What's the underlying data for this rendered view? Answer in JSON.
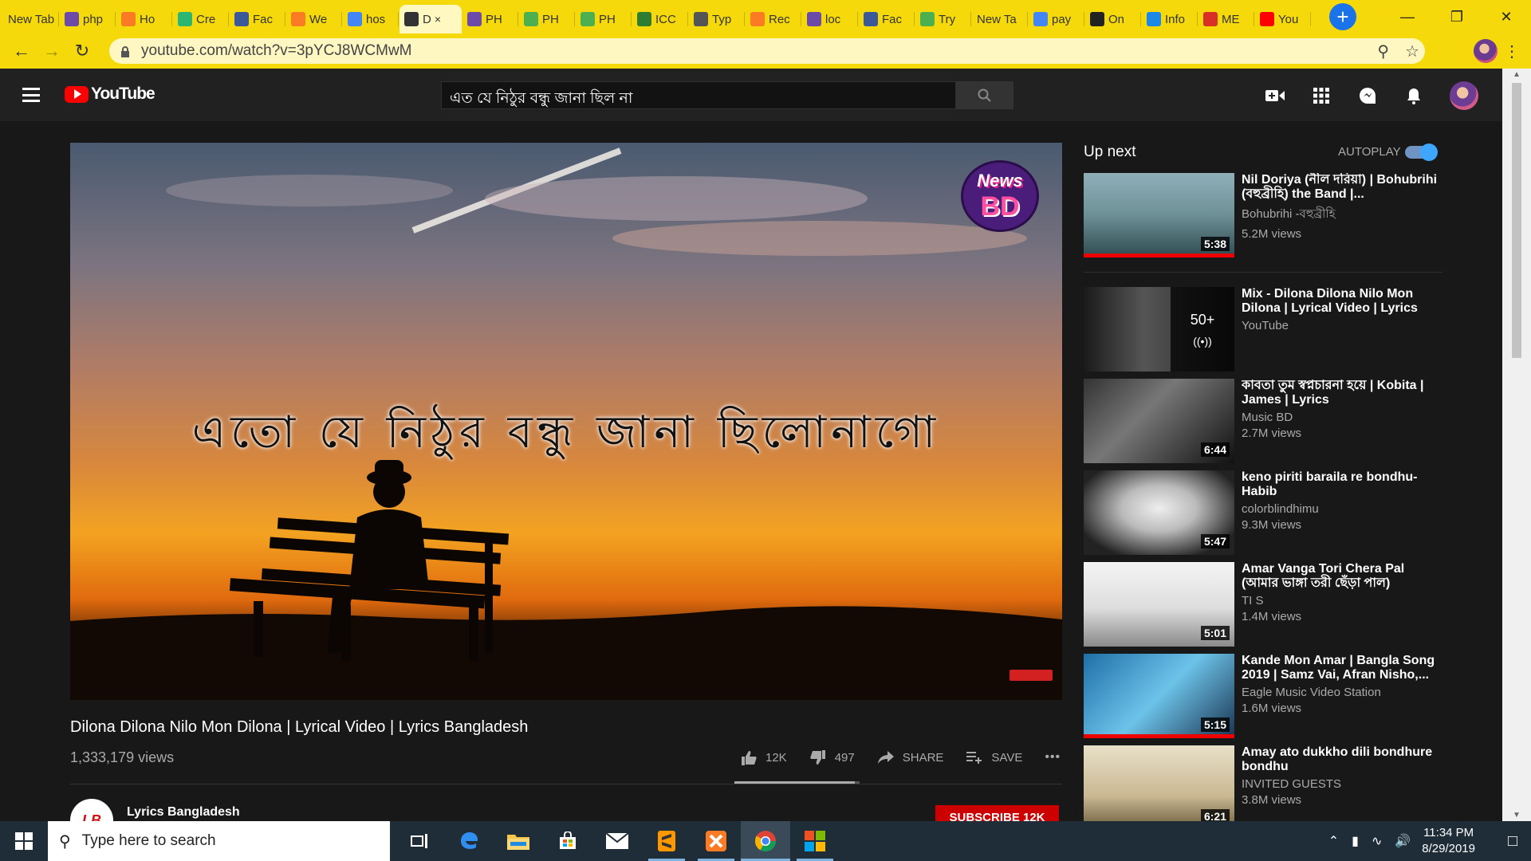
{
  "browser": {
    "tabs": [
      {
        "label": "New Tab",
        "icon": "none",
        "color": "#f5d90a"
      },
      {
        "label": "php",
        "icon": "php-icon",
        "color": "#6c4aa8"
      },
      {
        "label": "Ho",
        "icon": "xampp-icon",
        "color": "#fb7a24"
      },
      {
        "label": "Cre",
        "icon": "circle-icon",
        "color": "#2bb673"
      },
      {
        "label": "Fac",
        "icon": "facebook-icon",
        "color": "#3b5998"
      },
      {
        "label": "We",
        "icon": "xampp-icon",
        "color": "#fb7a24"
      },
      {
        "label": "hos",
        "icon": "google-icon",
        "color": "#4285f4"
      },
      {
        "label": "D",
        "icon": "speaker-icon",
        "color": "#333333",
        "active": true
      },
      {
        "label": "PH",
        "icon": "php-icon",
        "color": "#6c4aa8"
      },
      {
        "label": "PH",
        "icon": "w3-icon",
        "color": "#4caf50"
      },
      {
        "label": "PH",
        "icon": "w3-icon",
        "color": "#4caf50"
      },
      {
        "label": "ICC",
        "icon": "leaf-icon",
        "color": "#2e7d32"
      },
      {
        "label": "Typ",
        "icon": "photo-icon",
        "color": "#555555"
      },
      {
        "label": "Rec",
        "icon": "xampp-icon",
        "color": "#fb7a24"
      },
      {
        "label": "loc",
        "icon": "php-icon",
        "color": "#6c4aa8"
      },
      {
        "label": "Fac",
        "icon": "facebook-icon",
        "color": "#3b5998"
      },
      {
        "label": "Try",
        "icon": "w3-icon",
        "color": "#4caf50"
      },
      {
        "label": "New Ta",
        "icon": "none",
        "color": "#f5d90a"
      },
      {
        "label": "pay",
        "icon": "google-icon",
        "color": "#4285f4"
      },
      {
        "label": "On",
        "icon": "globe-icon",
        "color": "#222222"
      },
      {
        "label": "Info",
        "icon": "wave-icon",
        "color": "#1e88e5"
      },
      {
        "label": "ME",
        "icon": "gmail-icon",
        "color": "#d93025"
      },
      {
        "label": "You",
        "icon": "youtube-icon",
        "color": "#ff0000"
      }
    ],
    "tab_close": "×",
    "new_tab": "+",
    "url": "youtube.com/watch?v=3pYCJ8WCMwM"
  },
  "youtube": {
    "logo_text": "YouTube",
    "search_value": "এত যে নিঠুর বন্ধু জানা ছিল না",
    "video": {
      "overlay_lyric": "এতো যে নিঠুর বন্ধু জানা ছিলোনাগো",
      "badge_top": "News",
      "badge_bottom": "BD",
      "title": "Dilona Dilona Nilo Mon Dilona | Lyrical Video | Lyrics Bangladesh",
      "views": "1,333,179 views",
      "likes": "12K",
      "dislikes": "497",
      "like_ratio": 0.96,
      "share": "SHARE",
      "save": "SAVE",
      "more": "•••",
      "channel_name": "Lyrics Bangladesh",
      "channel_initials": "LB",
      "subscribe": "SUBSCRIBE 12K"
    },
    "sidebar": {
      "up_next": "Up next",
      "autoplay": "AUTOPLAY",
      "items": [
        {
          "title": "Nil Doriya (নীল দরিয়া) | Bohubrihi (বহুব্রীহি) the Band |...",
          "channel": "Bohubrihi -বহুব্রীহি",
          "views": "5.2M views",
          "duration": "5:38"
        },
        {
          "title": "Mix - Dilona Dilona Nilo Mon Dilona | Lyrical Video | Lyrics Bangladesh",
          "channel": "YouTube",
          "views": "",
          "duration": "",
          "mix_count": "50+"
        },
        {
          "title": "কাবতা তুম স্বপ্নচারনা হয়ে | Kobita | James | Lyrics",
          "channel": "Music BD",
          "views": "2.7M views",
          "duration": "6:44"
        },
        {
          "title": "keno piriti baraila re bondhu-Habib",
          "channel": "colorblindhimu",
          "views": "9.3M views",
          "duration": "5:47"
        },
        {
          "title": "Amar Vanga Tori Chera Pal (আমার ভাঙ্গা তরী ছেঁড়া পাল)",
          "channel": "TI S",
          "views": "1.4M views",
          "duration": "5:01"
        },
        {
          "title": "Kande Mon Amar | Bangla Song 2019 | Samz Vai, Afran Nisho,...",
          "channel": "Eagle Music Video Station",
          "views": "1.6M views",
          "duration": "5:15"
        },
        {
          "title": "Amay ato dukkho dili bondhure bondhu",
          "channel": "INVITED GUESTS",
          "views": "3.8M views",
          "duration": "6:21"
        }
      ]
    }
  },
  "taskbar": {
    "search_placeholder": "Type here to search",
    "time": "11:34 PM",
    "date": "8/29/2019"
  }
}
